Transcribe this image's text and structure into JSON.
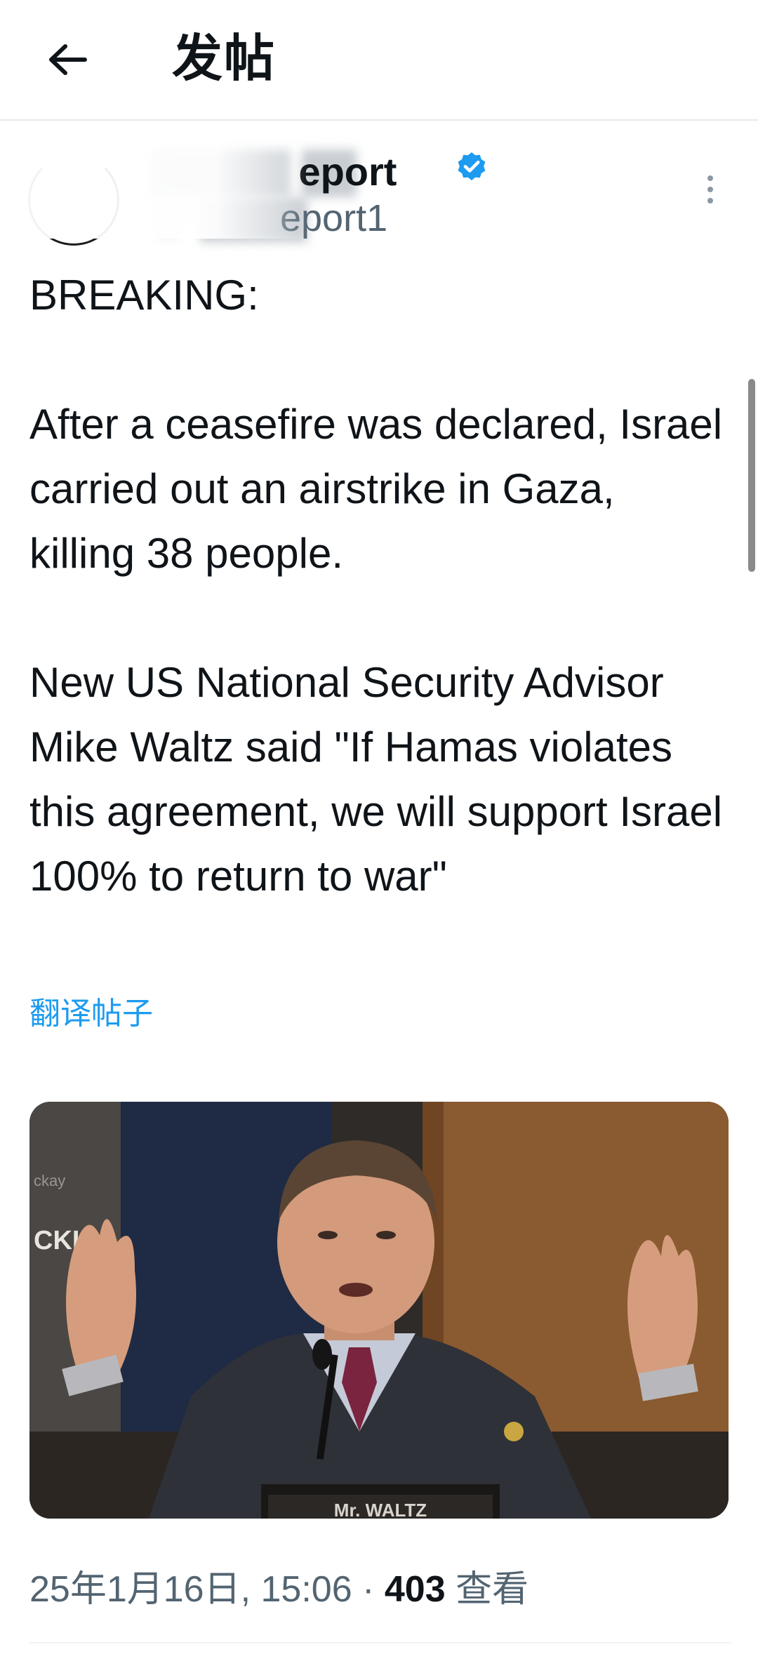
{
  "header": {
    "title": "发帖"
  },
  "author": {
    "display_name_visible": "Report",
    "handle_visible": "Report1",
    "verified": true
  },
  "tweet": {
    "text": "BREAKING:\n\nAfter a ceasefire was declared, Israel carried out an airstrike in Gaza, killing 38 people.\n\nNew US National Security Advisor Mike Waltz said \"If Hamas violates this agreement, we will support Israel 100% to return to war\"",
    "translate_label": "翻译帖子"
  },
  "media": {
    "placard_text": "Mr. WALTZ"
  },
  "meta": {
    "date_time": "25年1月16日, 15:06",
    "separator": "·",
    "views_count": "403",
    "views_label": "查看"
  },
  "colors": {
    "accent": "#1d9bf0",
    "text_primary": "#0f1419",
    "text_secondary": "#536471"
  }
}
